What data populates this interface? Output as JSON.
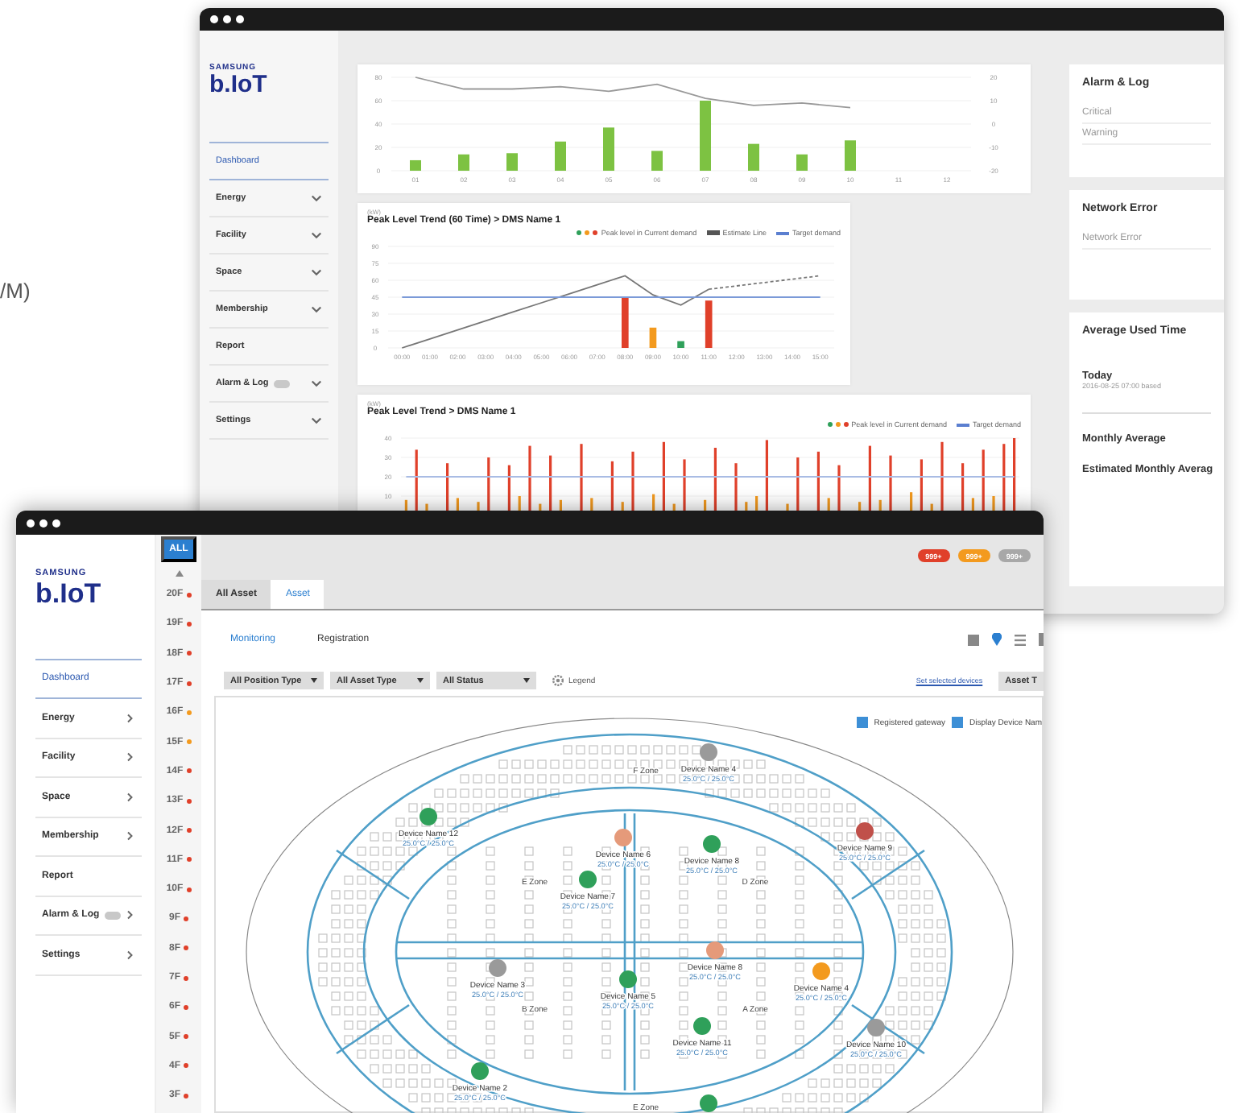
{
  "stray_text": "/M)",
  "back_window": {
    "logo": {
      "brand": "SAMSUNG",
      "product": "b.IoT"
    },
    "nav": [
      {
        "label": "Dashboard",
        "selected": true,
        "expandable": false,
        "badge": false
      },
      {
        "label": "Energy",
        "selected": false,
        "expandable": true,
        "badge": false
      },
      {
        "label": "Facility",
        "selected": false,
        "expandable": true,
        "badge": false
      },
      {
        "label": "Space",
        "selected": false,
        "expandable": true,
        "badge": false
      },
      {
        "label": "Membership",
        "selected": false,
        "expandable": true,
        "badge": false
      },
      {
        "label": "Report",
        "selected": false,
        "expandable": false,
        "badge": false
      },
      {
        "label": "Alarm & Log",
        "selected": false,
        "expandable": true,
        "badge": true
      },
      {
        "label": "Settings",
        "selected": false,
        "expandable": true,
        "badge": false
      }
    ],
    "charts": [
      {
        "kind": "usage",
        "chart_data": {
          "type": "bar",
          "stacked": false,
          "grid": true,
          "categories": [
            "01",
            "02",
            "03",
            "04",
            "05",
            "06",
            "07",
            "08",
            "09",
            "10",
            "11",
            "12"
          ],
          "ylim": [
            0,
            80
          ],
          "yticks": [
            0,
            20,
            40,
            60,
            80
          ],
          "y2lim": [
            -20,
            20
          ],
          "y2ticks": [
            -20,
            -10,
            0,
            10,
            20
          ],
          "series": [
            {
              "color": "#7dc242",
              "values": [
                9,
                14,
                15,
                25,
                37,
                17,
                60,
                23,
                14,
                26,
                null,
                null
              ]
            },
            {
              "type": "line",
              "axis": "y2",
              "color": "#999999",
              "values": [
                20,
                15,
                15,
                16,
                14,
                17,
                11,
                8,
                9,
                7,
                null,
                null
              ]
            }
          ]
        }
      },
      {
        "kind": "peak",
        "unit": "(kW)",
        "title": "Peak Level Trend (60 Time) > DMS Name 1",
        "legend": [
          {
            "kind": "dots",
            "label": "Peak level in Current demand"
          },
          {
            "kind": "estimate",
            "label": "Estimate Line"
          },
          {
            "kind": "target",
            "label": "Target demand"
          }
        ],
        "chart_data": {
          "type": "bar",
          "stacked": false,
          "grid": true,
          "categories": [
            "00:00",
            "01:00",
            "02:00",
            "03:00",
            "04:00",
            "05:00",
            "06:00",
            "07:00",
            "08:00",
            "09:00",
            "10:00",
            "11:00",
            "12:00",
            "13:00",
            "14:00",
            "15:00"
          ],
          "ylim": [
            0,
            90
          ],
          "yticks": [
            0,
            15,
            30,
            45,
            60,
            75,
            90
          ],
          "series": [
            {
              "color": "#e0402a",
              "values": [
                null,
                null,
                null,
                null,
                null,
                null,
                null,
                null,
                45,
                null,
                null,
                42,
                null,
                null,
                null,
                null
              ]
            },
            {
              "color": "#f39a1e",
              "values": [
                null,
                null,
                null,
                null,
                null,
                null,
                null,
                null,
                null,
                18,
                null,
                null,
                null,
                null,
                null,
                null
              ]
            },
            {
              "color": "#2fa05a",
              "values": [
                null,
                null,
                null,
                null,
                null,
                null,
                null,
                null,
                null,
                null,
                6,
                null,
                null,
                null,
                null,
                null
              ]
            },
            {
              "type": "line",
              "color": "#777777",
              "values": [
                0,
                8,
                16,
                24,
                32,
                40,
                48,
                56,
                64,
                47,
                38,
                52,
                null,
                null,
                null,
                null
              ]
            },
            {
              "type": "line",
              "line_style": "dashed",
              "color": "#777777",
              "values": [
                null,
                null,
                null,
                null,
                null,
                null,
                null,
                null,
                null,
                null,
                null,
                52,
                55,
                58,
                61,
                64
              ]
            },
            {
              "type": "line",
              "color": "#7b9ad8",
              "values": [
                45,
                45,
                45,
                45,
                45,
                45,
                45,
                45,
                45,
                45,
                45,
                45,
                45,
                45,
                45,
                45
              ]
            }
          ]
        }
      },
      {
        "kind": "peak_bars",
        "unit": "(kW)",
        "title": "Peak Level Trend > DMS Name 1",
        "legend": [
          {
            "kind": "dots",
            "label": "Peak level in Current demand"
          },
          {
            "kind": "target",
            "label": "Target demand"
          }
        ],
        "chart_data": {
          "type": "bar",
          "stacked": false,
          "grid": true,
          "ylim": [
            0,
            40
          ],
          "yticks": [
            10,
            20,
            30,
            40
          ],
          "series": [
            {
              "color": "#e0402a",
              "values": [
                null,
                34,
                null,
                null,
                27,
                null,
                null,
                null,
                30,
                null,
                26,
                null,
                36,
                null,
                31,
                null,
                null,
                37,
                null,
                null,
                28,
                null,
                33,
                null,
                null,
                38,
                null,
                29,
                null,
                null,
                35,
                null,
                27,
                null,
                null,
                39,
                null,
                null,
                30,
                null,
                33,
                null,
                26,
                null,
                null,
                36,
                null,
                31,
                null,
                null,
                29,
                null,
                38,
                null,
                27,
                null,
                34,
                null,
                37,
                40
              ]
            },
            {
              "color": "#f39a1e",
              "values": [
                8,
                null,
                6,
                null,
                null,
                9,
                null,
                7,
                null,
                null,
                null,
                10,
                null,
                6,
                null,
                8,
                null,
                null,
                9,
                null,
                null,
                7,
                null,
                null,
                11,
                null,
                6,
                null,
                null,
                8,
                null,
                null,
                null,
                7,
                10,
                null,
                null,
                6,
                null,
                null,
                null,
                9,
                null,
                null,
                7,
                null,
                8,
                null,
                null,
                12,
                null,
                6,
                null,
                null,
                null,
                9,
                null,
                10,
                null,
                null
              ]
            },
            {
              "type": "line",
              "color": "#a9bce4",
              "values": [
                20,
                20,
                20,
                20,
                20,
                20,
                20,
                20,
                20,
                20,
                20,
                20,
                20,
                20,
                20,
                20,
                20,
                20,
                20,
                20,
                20,
                20,
                20,
                20,
                20,
                20,
                20,
                20,
                20,
                20,
                20,
                20,
                20,
                20,
                20,
                20,
                20,
                20,
                20,
                20,
                20,
                20,
                20,
                20,
                20,
                20,
                20,
                20,
                20,
                20,
                20,
                20,
                20,
                20,
                20,
                20,
                20,
                20,
                20,
                20
              ]
            }
          ]
        }
      }
    ],
    "panels": [
      {
        "title": "Alarm & Log",
        "items": [
          {
            "kind": "label",
            "text": "Critical"
          },
          {
            "kind": "label",
            "text": "Warning"
          }
        ]
      },
      {
        "title": "Network Error",
        "items": [
          {
            "kind": "label",
            "text": "Network Error"
          }
        ]
      },
      {
        "title": "Average Used Time",
        "items": [
          {
            "kind": "heading",
            "text": "Today"
          },
          {
            "kind": "note",
            "text": "2016-08-25 07:00 based"
          },
          {
            "kind": "heading",
            "text": "Monthly Average"
          },
          {
            "kind": "heading",
            "text": "Estimated Monthly Averag"
          }
        ]
      }
    ]
  },
  "front_window": {
    "logo": {
      "brand": "SAMSUNG",
      "product": "b.IoT"
    },
    "nav": [
      {
        "label": "Dashboard",
        "selected": true,
        "expandable": false,
        "badge": false
      },
      {
        "label": "Energy",
        "selected": false,
        "expandable": true,
        "badge": false
      },
      {
        "label": "Facility",
        "selected": false,
        "expandable": true,
        "badge": false
      },
      {
        "label": "Space",
        "selected": false,
        "expandable": true,
        "badge": false
      },
      {
        "label": "Membership",
        "selected": false,
        "expandable": true,
        "badge": false
      },
      {
        "label": "Report",
        "selected": false,
        "expandable": false,
        "badge": false
      },
      {
        "label": "Alarm & Log",
        "selected": false,
        "expandable": true,
        "badge": true
      },
      {
        "label": "Settings",
        "selected": false,
        "expandable": true,
        "badge": false
      }
    ],
    "floors": [
      {
        "label": "ALL",
        "selected": true
      },
      {
        "label": "20F",
        "selected": false,
        "color": "#e0402a"
      },
      {
        "label": "19F",
        "selected": false,
        "color": "#e0402a"
      },
      {
        "label": "18F",
        "selected": false,
        "color": "#e0402a"
      },
      {
        "label": "17F",
        "selected": false,
        "color": "#e0402a"
      },
      {
        "label": "16F",
        "selected": false,
        "color": "#f39a1e"
      },
      {
        "label": "15F",
        "selected": false,
        "color": "#f39a1e"
      },
      {
        "label": "14F",
        "selected": false,
        "color": "#e0402a"
      },
      {
        "label": "13F",
        "selected": false,
        "color": "#e0402a"
      },
      {
        "label": "12F",
        "selected": false,
        "color": "#e0402a"
      },
      {
        "label": "11F",
        "selected": false,
        "color": "#e0402a"
      },
      {
        "label": "10F",
        "selected": false,
        "color": "#e0402a"
      },
      {
        "label": "9F",
        "selected": false,
        "color": "#e0402a"
      },
      {
        "label": "8F",
        "selected": false,
        "color": "#e0402a"
      },
      {
        "label": "7F",
        "selected": false,
        "color": "#e0402a"
      },
      {
        "label": "6F",
        "selected": false,
        "color": "#e0402a"
      },
      {
        "label": "5F",
        "selected": false,
        "color": "#e0402a"
      },
      {
        "label": "4F",
        "selected": false,
        "color": "#e0402a"
      },
      {
        "label": "3F",
        "selected": false,
        "color": "#e0402a"
      }
    ],
    "badges": [
      {
        "text": "999+",
        "color": "#e0402a"
      },
      {
        "text": "999+",
        "color": "#f39a1e"
      },
      {
        "text": "999+",
        "color": "#a8a8a8"
      }
    ],
    "tabs": [
      {
        "label": "All Asset",
        "selected": false
      },
      {
        "label": "Asset",
        "selected": true
      }
    ],
    "subtabs": [
      {
        "label": "Monitoring",
        "selected": true
      },
      {
        "label": "Registration",
        "selected": false
      }
    ],
    "view_buttons": [
      {
        "kind": "grid",
        "selected": false
      },
      {
        "kind": "pin",
        "selected": true
      },
      {
        "kind": "list",
        "selected": false
      },
      {
        "kind": "more",
        "selected": false
      }
    ],
    "filters": [
      "All Position Type",
      "All Asset Type",
      "All Status"
    ],
    "legend_button": "Legend",
    "link": "Set selected devices",
    "asset_button": "Asset T",
    "map": {
      "options": [
        {
          "label": "Registered gateway",
          "checked": true
        },
        {
          "label": "Display Device Nam",
          "checked": true
        }
      ],
      "zones": [
        "F Zone",
        "E Zone",
        "D Zone",
        "B Zone",
        "A Zone",
        "E Zone"
      ],
      "devices": [
        {
          "name": "Device Name 4",
          "reading": "25.0°C / 25.0°C",
          "color": "#9a9a9a"
        },
        {
          "name": "Device Name 12",
          "reading": "25.0°C / 25.0°C",
          "color": "#2fa05a"
        },
        {
          "name": "Device Name 6",
          "reading": "25.0°C / 25.0°C",
          "color": "#e59a7a"
        },
        {
          "name": "Device Name 8",
          "reading": "25.0°C / 25.0°C",
          "color": "#2fa05a"
        },
        {
          "name": "Device Name 9",
          "reading": "25.0°C / 25.0°C",
          "color": "#c0504a"
        },
        {
          "name": "Device Name 7",
          "reading": "25.0°C / 25.0°C",
          "color": "#2fa05a"
        },
        {
          "name": "Device Name 3",
          "reading": "25.0°C / 25.0°C",
          "color": "#9a9a9a"
        },
        {
          "name": "Device Name 5",
          "reading": "25.0°C / 25.0°C",
          "color": "#2fa05a"
        },
        {
          "name": "Device Name 8",
          "reading": "25.0°C / 25.0°C",
          "color": "#e59a7a"
        },
        {
          "name": "Device Name 4",
          "reading": "25.0°C / 25.0°C",
          "color": "#f39a1e"
        },
        {
          "name": "Device Name 11",
          "reading": "25.0°C / 25.0°C",
          "color": "#2fa05a"
        },
        {
          "name": "Device Name 10",
          "reading": "25.0°C / 25.0°C",
          "color": "#9a9a9a"
        },
        {
          "name": "Device Name 2",
          "reading": "25.0°C / 25.0°C",
          "color": "#2fa05a"
        },
        {
          "color": "#2fa05a"
        }
      ]
    }
  }
}
